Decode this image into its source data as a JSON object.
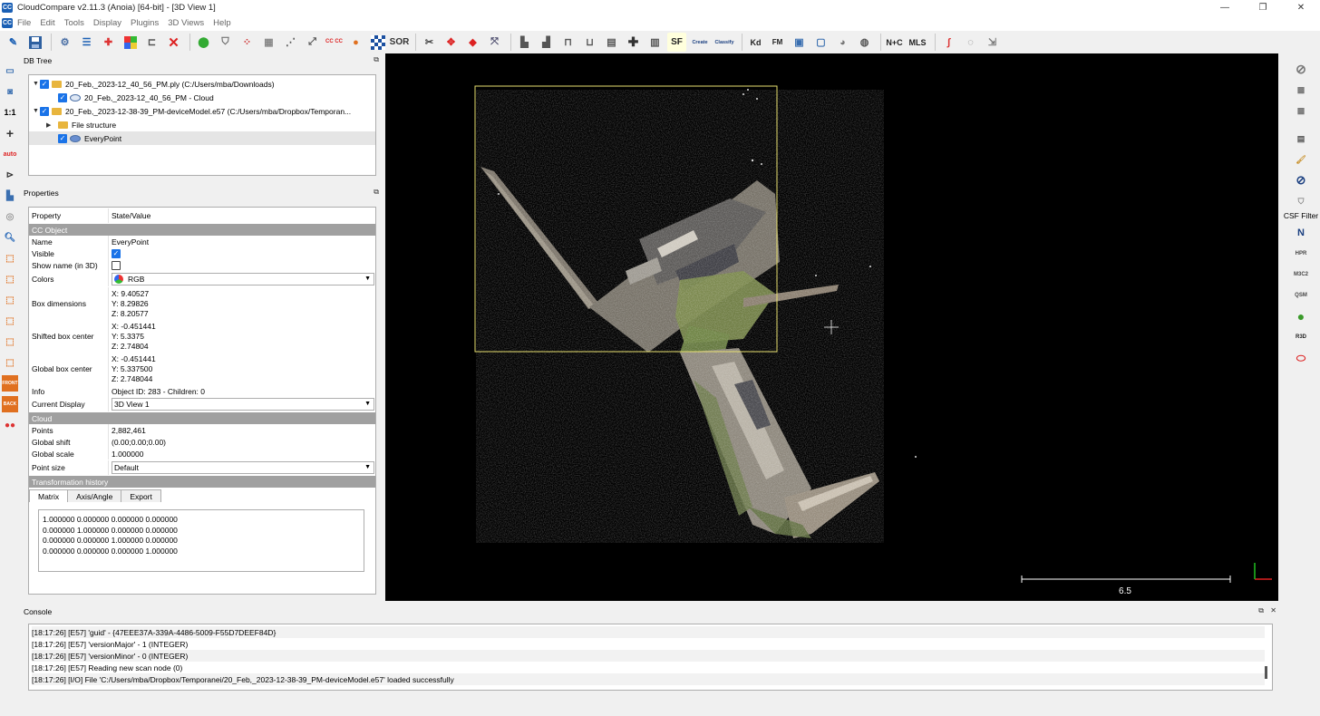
{
  "window": {
    "title": "CloudCompare v2.11.3 (Anoia) [64-bit] - [3D View 1]",
    "app_icon_text": "CC",
    "controls": [
      "—",
      "❐",
      "✕"
    ]
  },
  "menu": [
    "File",
    "Edit",
    "Tools",
    "Display",
    "Plugins",
    "3D Views",
    "Help"
  ],
  "toolbar": {
    "labels": {
      "cc": "CC CC",
      "sor": "SOR",
      "sf": "SF",
      "canupo_create": "Create",
      "canupo_classify": "Classify",
      "kd": "Kd",
      "fm": "FM",
      "nc": "N+C",
      "mls": "MLS"
    }
  },
  "left_toolbar": {
    "one_to_one": "1:1",
    "auto": "auto",
    "front": "FRONT",
    "back": "BACK"
  },
  "right_toolbar": {
    "csf_label": "CSF Filter",
    "north": "N",
    "hpr": "HPR",
    "m3c2": "M3C2",
    "qsm": "QSM",
    "r3d": "R3D"
  },
  "db_tree": {
    "title": "DB Tree",
    "items": [
      {
        "label": "20_Feb,_2023-12_40_56_PM.ply (C:/Users/mba/Downloads)",
        "level": 0,
        "type": "folder",
        "checked": true,
        "expanded": true
      },
      {
        "label": "20_Feb,_2023-12_40_56_PM - Cloud",
        "level": 1,
        "type": "cloud",
        "checked": true
      },
      {
        "label": "20_Feb,_2023-12-38-39_PM-deviceModel.e57 (C:/Users/mba/Dropbox/Temporan...",
        "level": 0,
        "type": "folder",
        "checked": true,
        "expanded": true
      },
      {
        "label": "File structure",
        "level": 1,
        "type": "folder",
        "checked": null,
        "expanded": false
      },
      {
        "label": "EveryPoint",
        "level": 1,
        "type": "cloud",
        "checked": true,
        "selected": true
      }
    ]
  },
  "properties": {
    "title": "Properties",
    "header": {
      "property": "Property",
      "value": "State/Value"
    },
    "sections": {
      "cc_object": "CC Object",
      "cloud": "Cloud",
      "transformation": "Transformation history"
    },
    "name": {
      "key": "Name",
      "value": "EveryPoint"
    },
    "visible": {
      "key": "Visible",
      "checked": true
    },
    "show_name": {
      "key": "Show name (in 3D)",
      "checked": false
    },
    "colors": {
      "key": "Colors",
      "value": "RGB"
    },
    "box_dimensions": {
      "key": "Box dimensions",
      "x": "X: 9.40527",
      "y": "Y: 8.29826",
      "z": "Z: 8.20577"
    },
    "shifted_center": {
      "key": "Shifted box center",
      "x": "X: -0.451441",
      "y": "Y: 5.3375",
      "z": "Z: 2.74804"
    },
    "global_center": {
      "key": "Global box center",
      "x": "X: -0.451441",
      "y": "Y: 5.337500",
      "z": "Z: 2.748044"
    },
    "info": {
      "key": "Info",
      "value": "Object ID: 283 - Children: 0"
    },
    "current_display": {
      "key": "Current Display",
      "value": "3D View 1"
    },
    "points": {
      "key": "Points",
      "value": "2,882,461"
    },
    "global_shift": {
      "key": "Global shift",
      "value": "(0.00;0.00;0.00)"
    },
    "global_scale": {
      "key": "Global scale",
      "value": "1.000000"
    },
    "point_size": {
      "key": "Point size",
      "value": "Default"
    },
    "tabs": [
      "Matrix",
      "Axis/Angle",
      "Export"
    ],
    "matrix": [
      "1.000000 0.000000 0.000000 0.000000",
      "0.000000 1.000000 0.000000 0.000000",
      "0.000000 0.000000 1.000000 0.000000",
      "0.000000 0.000000 0.000000 1.000000"
    ]
  },
  "view": {
    "scale_label": "6.5",
    "bbox_color": "#e8e070",
    "background": "#000000"
  },
  "console": {
    "title": "Console",
    "lines": [
      "[18:17:26] [E57] 'guid' - {47EEE37A-339A-4486-5009-F55D7DEEF84D}",
      "[18:17:26] [E57] 'versionMajor' - 1 (INTEGER)",
      "[18:17:26] [E57] 'versionMinor' - 0 (INTEGER)",
      "[18:17:26] [E57] Reading new scan node (0)",
      "[18:17:26] [I/O] File 'C:/Users/mba/Dropbox/Temporanei/20_Feb,_2023-12-38-39_PM-deviceModel.e57' loaded successfully"
    ]
  }
}
